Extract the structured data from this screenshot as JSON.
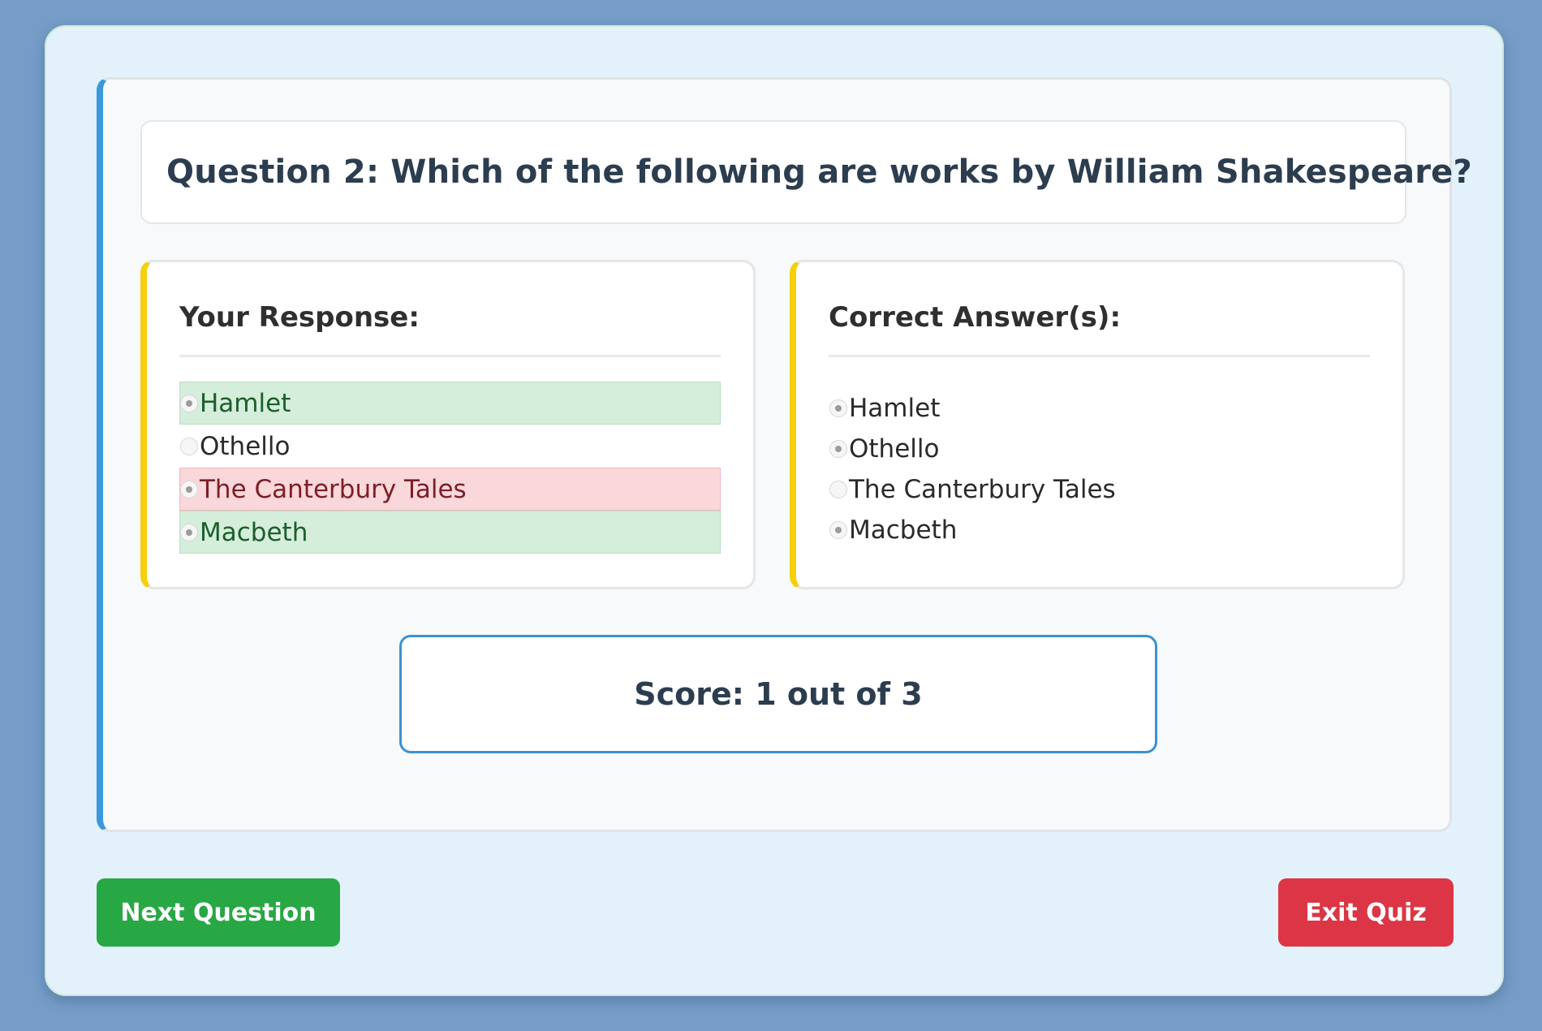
{
  "question": {
    "title": "Question 2: Which of the following are works by William Shakespeare?"
  },
  "response_panel": {
    "heading": "Your Response:",
    "options": [
      {
        "label": "Hamlet",
        "selected": true,
        "state": "correct"
      },
      {
        "label": "Othello",
        "selected": false,
        "state": "none"
      },
      {
        "label": "The Canterbury Tales",
        "selected": true,
        "state": "incorrect"
      },
      {
        "label": "Macbeth",
        "selected": true,
        "state": "correct"
      }
    ]
  },
  "correct_panel": {
    "heading": "Correct Answer(s):",
    "options": [
      {
        "label": "Hamlet",
        "selected": true
      },
      {
        "label": "Othello",
        "selected": true
      },
      {
        "label": "The Canterbury Tales",
        "selected": false
      },
      {
        "label": "Macbeth",
        "selected": true
      }
    ]
  },
  "score": {
    "text": "Score: 1 out of 3"
  },
  "actions": {
    "next_label": "Next Question",
    "exit_label": "Exit Quiz"
  },
  "colors": {
    "page_background": "#759dc8",
    "panel_background": "#e3f1fb",
    "card_accent": "#3a98dc",
    "answer_accent": "#f6cf0c",
    "correct_highlight": "#d5eddb",
    "incorrect_highlight": "#f9d7da",
    "next_button": "#28a745",
    "exit_button": "#dc3545"
  }
}
